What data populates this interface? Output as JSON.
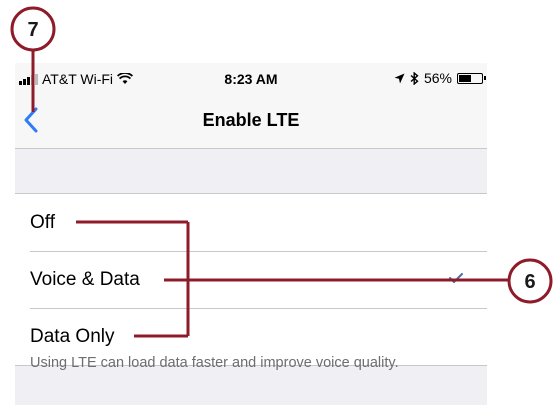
{
  "status_bar": {
    "carrier": "AT&T Wi-Fi",
    "time": "8:23 AM",
    "battery_percent": "56%",
    "battery_level": 0.56
  },
  "nav": {
    "back_icon": "chevron-left-icon",
    "title": "Enable LTE"
  },
  "options": [
    {
      "label": "Off",
      "selected": false
    },
    {
      "label": "Voice & Data",
      "selected": true
    },
    {
      "label": "Data Only",
      "selected": false
    }
  ],
  "footer_text": "Using LTE can load data faster and improve voice quality.",
  "callouts": [
    {
      "number": "7"
    },
    {
      "number": "6"
    }
  ],
  "colors": {
    "accent": "#2f7cf6",
    "callout": "#8e1b2a",
    "checkmark": "#4a6fa5"
  }
}
